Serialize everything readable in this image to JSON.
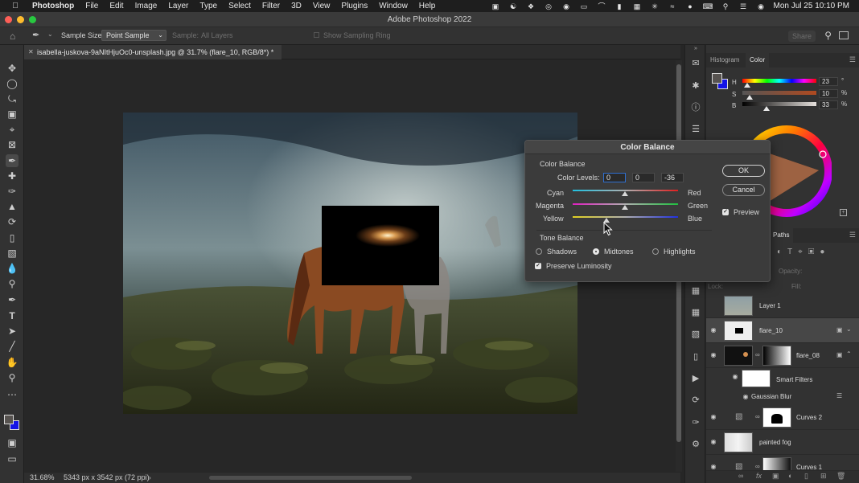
{
  "menubar": {
    "app_name": "Photoshop",
    "items": [
      "File",
      "Edit",
      "Image",
      "Layer",
      "Type",
      "Select",
      "Filter",
      "3D",
      "View",
      "Plugins",
      "Window",
      "Help"
    ],
    "datetime": "Mon Jul 25  10:10 PM"
  },
  "window": {
    "title": "Adobe Photoshop 2022"
  },
  "options": {
    "sample_size_label": "Sample Size:",
    "sample_size_value": "Point Sample",
    "sample_label": "Sample:",
    "sample_value": "All Layers",
    "sampling_ring": "Show Sampling Ring",
    "share": "Share"
  },
  "document": {
    "tab_title": "isabella-juskova-9aNItHjuOc0-unsplash.jpg @ 31.7% (flare_10, RGB/8*) *",
    "zoom": "31.68%",
    "dimensions": "5343 px x 3542 px (72 ppi)"
  },
  "color_panel": {
    "tabs": [
      "Histogram",
      "Color"
    ],
    "active_tab": "Color",
    "h_label": "H",
    "h_value": "23",
    "h_unit": "°",
    "s_label": "S",
    "s_value": "10",
    "s_unit": "%",
    "b_label": "B",
    "b_value": "33",
    "b_unit": "%",
    "h_fraction": 0.064,
    "s_fraction": 0.1,
    "b_fraction": 0.33,
    "foreground_color": "#575350",
    "background_color": "#1414e6"
  },
  "layers_panel": {
    "visible_tab": "Paths",
    "opacity_label": "Opacity:",
    "fill_label": "Fill:",
    "lock_label": "Lock:",
    "layers": [
      {
        "name": "Layer 1",
        "visible": false
      },
      {
        "name": "flare_10",
        "visible": true,
        "selected": true
      },
      {
        "name": "flare_08",
        "visible": true
      },
      {
        "name": "Smart Filters",
        "visible": true
      },
      {
        "name": "Gaussian Blur",
        "visible": true
      },
      {
        "name": "Curves 2",
        "visible": true
      },
      {
        "name": "painted fog",
        "visible": true
      },
      {
        "name": "Curves 1",
        "visible": true
      }
    ]
  },
  "dialog": {
    "title": "Color Balance",
    "section_color_balance": "Color Balance",
    "color_levels_label": "Color Levels:",
    "levels": [
      "0",
      "0",
      "-36"
    ],
    "sliders": [
      {
        "left": "Cyan",
        "right": "Red",
        "value": 0
      },
      {
        "left": "Magenta",
        "right": "Green",
        "value": 0
      },
      {
        "left": "Yellow",
        "right": "Blue",
        "value": -36
      }
    ],
    "section_tone_balance": "Tone Balance",
    "tones": [
      "Shadows",
      "Midtones",
      "Highlights"
    ],
    "selected_tone": "Midtones",
    "preserve_luminosity": "Preserve Luminosity",
    "ok": "OK",
    "cancel": "Cancel",
    "preview": "Preview"
  }
}
